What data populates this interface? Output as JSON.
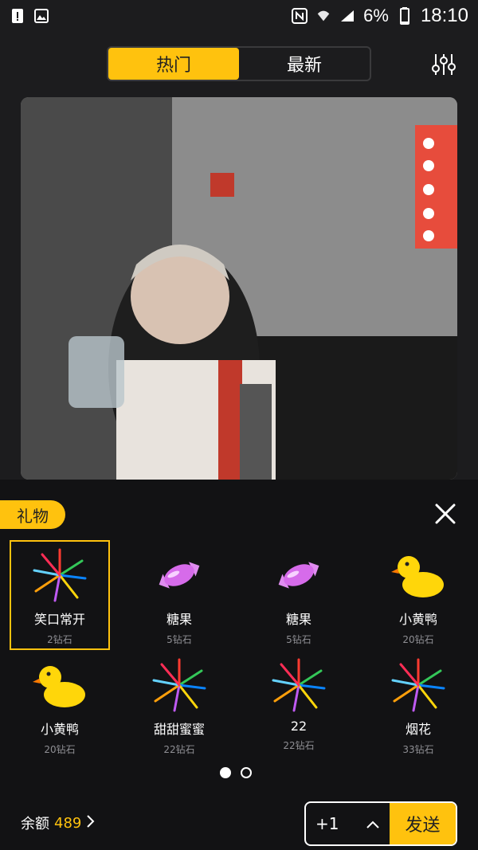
{
  "status_bar": {
    "battery": "6%",
    "time": "18:10",
    "left_icons": [
      "alert-icon",
      "image-icon"
    ],
    "right_icons": [
      "nfc-icon",
      "wifi-icon",
      "signal-icon",
      "battery-icon"
    ]
  },
  "header": {
    "tabs": [
      {
        "label": "热门",
        "active": true
      },
      {
        "label": "最新",
        "active": false
      }
    ]
  },
  "gift_panel": {
    "title": "礼物",
    "gifts": [
      {
        "name": "笑口常开",
        "price": "2钻石",
        "icon": "fireworks-icon"
      },
      {
        "name": "糖果",
        "price": "5钻石",
        "icon": "candy-icon"
      },
      {
        "name": "糖果",
        "price": "5钻石",
        "icon": "candy-icon"
      },
      {
        "name": "小黄鸭",
        "price": "20钻石",
        "icon": "duck-icon"
      },
      {
        "name": "小黄鸭",
        "price": "20钻石",
        "icon": "duck-icon"
      },
      {
        "name": "甜甜蜜蜜",
        "price": "22钻石",
        "icon": "fireworks-icon"
      },
      {
        "name": "22",
        "price": "22钻石",
        "icon": "fireworks-icon"
      },
      {
        "name": "烟花",
        "price": "33钻石",
        "icon": "fireworks-icon"
      }
    ],
    "pager": {
      "pages": 2,
      "current": 1
    },
    "balance_label": "余额",
    "balance_amount": "489",
    "quantity": "+1",
    "send_label": "发送"
  },
  "colors": {
    "accent": "#ffc20e",
    "panel_bg": "#121214"
  }
}
